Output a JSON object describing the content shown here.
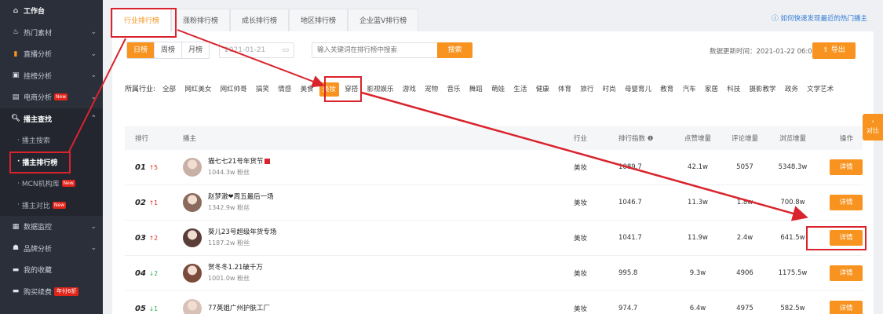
{
  "sidebar": {
    "workbench": "工作台",
    "items": [
      {
        "label": "热门素材"
      },
      {
        "label": "直播分析"
      },
      {
        "label": "挂榜分析"
      },
      {
        "label": "电商分析",
        "badge": "New"
      },
      {
        "label": "播主查找"
      }
    ],
    "subitems": [
      {
        "label": "播主搜索"
      },
      {
        "label": "播主排行榜"
      },
      {
        "label": "MCN机构库",
        "badge": "New"
      },
      {
        "label": "播主对比",
        "badge": "New"
      }
    ],
    "bottom": [
      {
        "label": "数据监控"
      },
      {
        "label": "品牌分析"
      },
      {
        "label": "我的收藏"
      },
      {
        "label": "购买续费",
        "badge": "年付6折"
      }
    ]
  },
  "tabs": [
    "行业排行榜",
    "涨粉排行榜",
    "成长排行榜",
    "地区排行榜",
    "企业蓝V排行榜"
  ],
  "help_link": "如何快速发现最近的热门播主",
  "toolbar": {
    "periods": [
      "日榜",
      "周榜",
      "月榜"
    ],
    "date": "2021-01-21",
    "search_placeholder": "输入关键词在排行榜中搜索",
    "search_label": "搜索",
    "updated": "数据更新时间：2021-01-22 06:00",
    "export_label": "导出"
  },
  "industry": {
    "label": "所属行业:",
    "items": [
      "全部",
      "网红美女",
      "网红帅哥",
      "搞笑",
      "情感",
      "美食",
      "美妆",
      "穿搭",
      "影视娱乐",
      "游戏",
      "宠物",
      "音乐",
      "舞蹈",
      "萌娃",
      "生活",
      "健康",
      "体育",
      "旅行",
      "时尚",
      "母婴育儿",
      "教育",
      "汽车",
      "家居",
      "科技",
      "摄影教学",
      "政务",
      "文学艺术"
    ],
    "selected": "美妆"
  },
  "table": {
    "headers": [
      "排行",
      "播主",
      "行业",
      "排行指数",
      "点赞增量",
      "评论增量",
      "浏览增量",
      "操作"
    ],
    "rows": [
      {
        "rank": "01",
        "trend": "↑5",
        "dir": "up",
        "name": "猫七七21号年货节",
        "fans": "1044.3w 粉丝",
        "industry": "美妆",
        "index": "1089.7",
        "likes": "42.1w",
        "comments": "5057",
        "views": "5348.3w",
        "action": "详情"
      },
      {
        "rank": "02",
        "trend": "↑1",
        "dir": "up",
        "name": "赵梦澈❤周五最后一场",
        "fans": "1342.9w 粉丝",
        "industry": "美妆",
        "index": "1046.7",
        "likes": "11.3w",
        "comments": "1.8w",
        "views": "700.8w",
        "action": "详情"
      },
      {
        "rank": "03",
        "trend": "↑2",
        "dir": "up",
        "name": "葵儿23号超级年货专场",
        "fans": "1187.2w 粉丝",
        "industry": "美妆",
        "index": "1041.7",
        "likes": "11.9w",
        "comments": "2.4w",
        "views": "641.5w",
        "action": "详情"
      },
      {
        "rank": "04",
        "trend": "↓2",
        "dir": "down",
        "name": "贺冬冬1.21破千万",
        "fans": "1001.0w 粉丝",
        "industry": "美妆",
        "index": "995.8",
        "likes": "9.3w",
        "comments": "4906",
        "views": "1175.5w",
        "action": "详情"
      },
      {
        "rank": "05",
        "trend": "↓1",
        "dir": "down",
        "name": "77英姐广州护肤工厂",
        "fans": "",
        "industry": "美妆",
        "index": "974.7",
        "likes": "6.4w",
        "comments": "4975",
        "views": "582.5w",
        "action": "详情"
      }
    ]
  },
  "compare_label": "对比",
  "colors": {
    "accent": "#f7931e",
    "sidebar": "#2b2f3a",
    "annotation": "#d9232d"
  }
}
